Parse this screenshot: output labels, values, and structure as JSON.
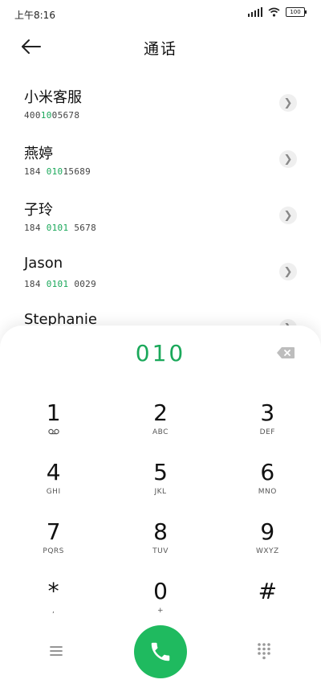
{
  "status": {
    "time": "上午8:16",
    "battery": "100"
  },
  "header": {
    "title": "通话"
  },
  "contacts": [
    {
      "name": "小米客服",
      "num_pre": "400",
      "num_hl": "10",
      "num_post": "05678"
    },
    {
      "name": "燕婷",
      "num_pre": "184 ",
      "num_hl": "010",
      "num_post": "15689"
    },
    {
      "name": "子玲",
      "num_pre": "184 ",
      "num_hl": "0101",
      "num_post": " 5678"
    },
    {
      "name": "Jason",
      "num_pre": "184 ",
      "num_hl": "0101",
      "num_post": " 0029"
    },
    {
      "name": "Stephanie",
      "num_pre": "",
      "num_hl": "",
      "num_post": ""
    }
  ],
  "dialer": {
    "digits": "010",
    "keys": [
      {
        "digit": "1",
        "letters": ""
      },
      {
        "digit": "2",
        "letters": "ABC"
      },
      {
        "digit": "3",
        "letters": "DEF"
      },
      {
        "digit": "4",
        "letters": "GHI"
      },
      {
        "digit": "5",
        "letters": "JKL"
      },
      {
        "digit": "6",
        "letters": "MNO"
      },
      {
        "digit": "7",
        "letters": "PQRS"
      },
      {
        "digit": "8",
        "letters": "TUV"
      },
      {
        "digit": "9",
        "letters": "WXYZ"
      },
      {
        "digit": "*",
        "letters": ","
      },
      {
        "digit": "0",
        "letters": "+"
      },
      {
        "digit": "#",
        "letters": ""
      }
    ]
  },
  "colors": {
    "accent": "#1aa85a",
    "call_button": "#1fba5f"
  },
  "icons": {
    "back": "arrow-left-icon",
    "chevron": "chevron-right-icon",
    "delete": "backspace-icon",
    "voicemail": "voicemail-icon",
    "menu": "menu-icon",
    "call": "phone-icon",
    "keypad": "keypad-icon"
  }
}
